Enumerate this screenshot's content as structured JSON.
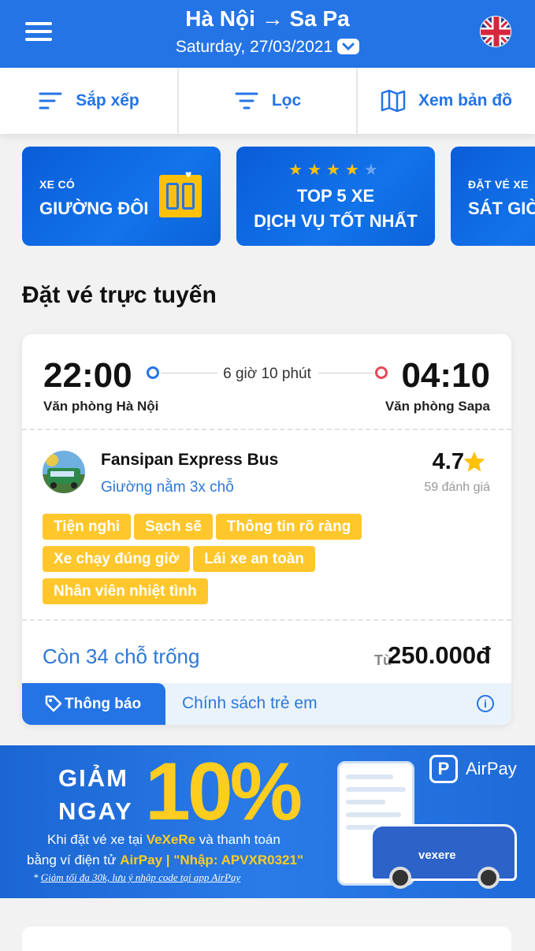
{
  "header": {
    "title": "Hà Nội → Sa Pa",
    "date": "Saturday, 27/03/2021",
    "menu_icon": "menu-icon",
    "language_icon": "uk-flag-icon",
    "accent_color": "#2474e5"
  },
  "toolbar": {
    "sort_label": "Sắp xếp",
    "filter_label": "Lọc",
    "map_label": "Xem bản đồ"
  },
  "promos": [
    {
      "small": "XE CÓ",
      "big": "GIƯỜNG ĐÔI"
    },
    {
      "line1": "TOP 5 XE",
      "line2": "DỊCH VỤ TỐT NHẤT",
      "stars": "★★★★★"
    },
    {
      "small": "ĐẶT VÉ XE",
      "big": "SÁT GIỜ"
    }
  ],
  "section_title": "Đặt vé trực tuyến",
  "trip": {
    "departure_time": "22:00",
    "arrival_time": "04:10",
    "duration": "6 giờ 10 phút",
    "departure_place": "Văn phòng Hà Nội",
    "arrival_place": "Văn phòng Sapa",
    "operator": "Fansipan Express Bus",
    "seat_type": "Giường nằm 3x chỗ",
    "rating": "4.7",
    "reviews": "59 đánh giá",
    "tags": [
      "Tiện nghi",
      "Sạch sẽ",
      "Thông tin rõ ràng",
      "Xe chạy đúng giờ",
      "Lái xe an toàn",
      "Nhân viên nhiệt tình"
    ],
    "seats_left": "Còn 34 chỗ trống",
    "price_prefix": "Từ",
    "price": "250.000đ",
    "notice_label": "Thông báo",
    "policy_label": "Chính sách trẻ em"
  },
  "airpay_banner": {
    "giam": "GIẢM",
    "ngay": "NGAY",
    "percent": "10%",
    "desc1_a": "Khi đặt vé xe tại ",
    "desc1_b": "VeXeRe",
    "desc1_c": " và thanh toán",
    "desc2_a": "bằng ví điện tử ",
    "desc2_b": "AirPay | \"Nhập: APVXR0321\"",
    "footnote_a": "* ",
    "footnote_b": "Giảm tối đa 30k, lưu ý nhập code tại app AirPay",
    "logo_text": "AirPay",
    "van_text": "vexere"
  }
}
